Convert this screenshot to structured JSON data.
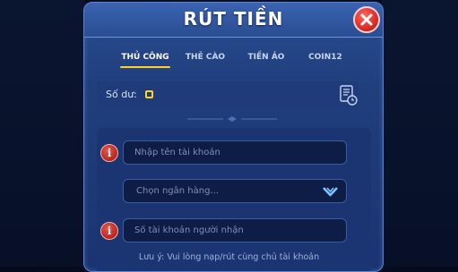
{
  "dialog": {
    "title": "RÚT TIỀN",
    "close_icon": "close-x-icon"
  },
  "tabs": [
    {
      "label": "THỦ CÔNG",
      "active": true
    },
    {
      "label": "THẺ CÀO",
      "active": false
    },
    {
      "label": "TIỀN ẢO",
      "active": false
    },
    {
      "label": "COIN12",
      "active": false
    }
  ],
  "balance": {
    "label": "Số dư:",
    "value_icon": "coin-icon",
    "history_icon": "history-document-icon"
  },
  "form": {
    "account_name": {
      "placeholder": "Nhập tên tài khoản",
      "value": ""
    },
    "bank_select": {
      "value": "Chọn ngân hàng..."
    },
    "receiver_account": {
      "placeholder": "Số tài khoản người nhận",
      "value": ""
    }
  },
  "note": "Lưu ý: Vui lòng nạp/rút cùng chủ tài khoản",
  "colors": {
    "accent": "#ffd21f",
    "panel": "#2a4d92",
    "close": "#e0302a"
  }
}
